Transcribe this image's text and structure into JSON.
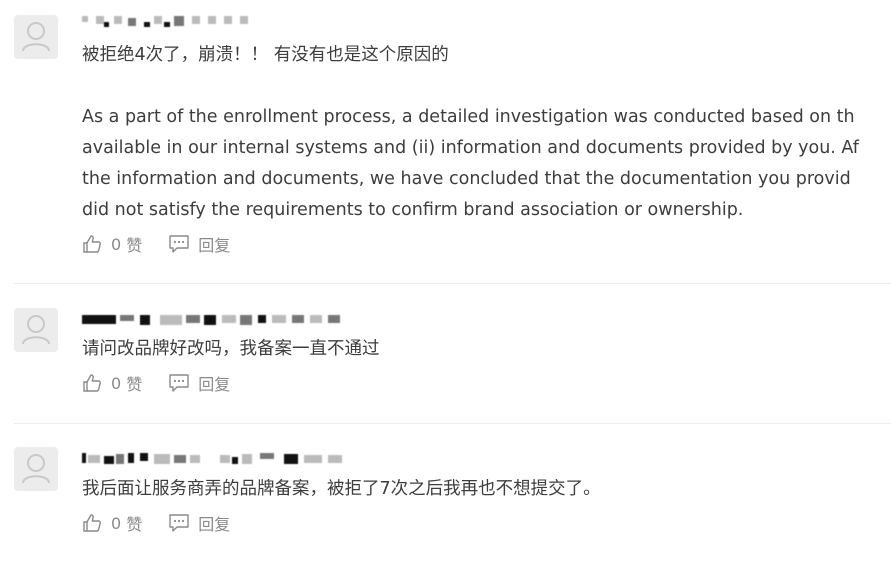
{
  "comments": [
    {
      "username": "",
      "content_lines": [
        "被拒绝4次了，崩溃！！ 有没有也是这个原因的"
      ],
      "quote_lines": [
        "As a part of the enrollment process, a detailed investigation was conducted based on th",
        "available in our internal systems and (ii) information and documents provided by you. Af",
        "the information and documents, we have concluded that the documentation you provid",
        "did not satisfy the requirements to confirm brand association or ownership."
      ],
      "like_count": "0",
      "like_label": "赞",
      "reply_label": "回复"
    },
    {
      "username": "",
      "content_lines": [
        "请问改品牌好改吗，我备案一直不通过"
      ],
      "quote_lines": [],
      "like_count": "0",
      "like_label": "赞",
      "reply_label": "回复"
    },
    {
      "username": "",
      "content_lines": [
        "我后面让服务商弄的品牌备案，被拒了7次之后我再也不想提交了。"
      ],
      "quote_lines": [],
      "like_count": "0",
      "like_label": "赞",
      "reply_label": "回复"
    }
  ],
  "icons": {
    "like": "thumbs-up-icon",
    "reply": "comment-bubble-icon",
    "avatar": "default-user-icon"
  },
  "colors": {
    "text": "#3d3d3d",
    "muted": "#8a8a8a",
    "avatar_bg": "#ececec",
    "divider": "#ececec"
  }
}
